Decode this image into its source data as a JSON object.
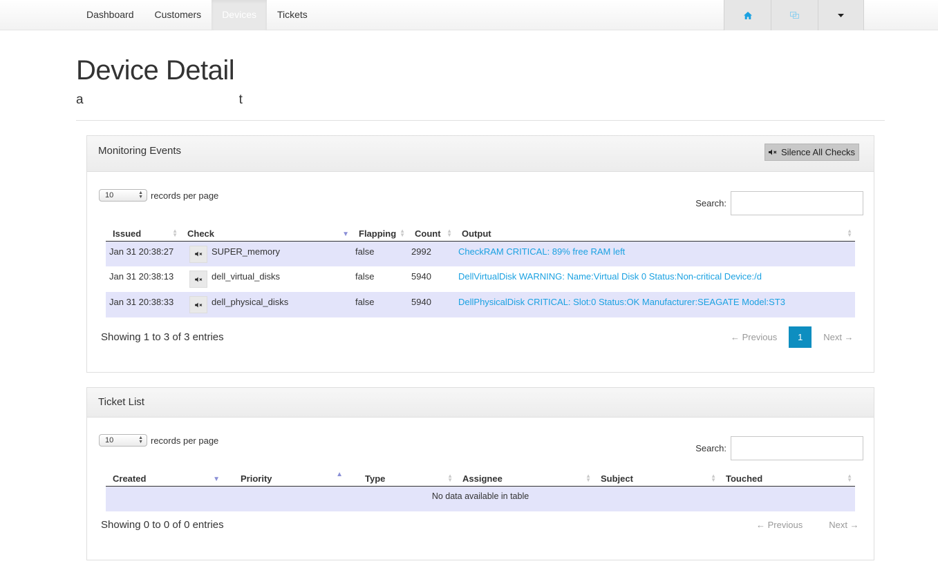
{
  "nav": {
    "items": [
      "Dashboard",
      "Customers",
      "Devices",
      "Tickets"
    ],
    "active": "Devices"
  },
  "header": {
    "title": "Device Detail",
    "subtitle_start": "a",
    "subtitle_end": "t"
  },
  "monitoring": {
    "title": "Monitoring Events",
    "silence_label": "Silence All Checks",
    "rpp_value": "10",
    "rpp_label": "records per page",
    "search_label": "Search:",
    "columns": [
      "Issued",
      "Check",
      "Flapping",
      "Count",
      "Output"
    ],
    "rows": [
      {
        "issued": "Jan 31 20:38:27",
        "check": "SUPER_memory",
        "flapping": "false",
        "count": "2992",
        "output": "CheckRAM CRITICAL: 89% free RAM left"
      },
      {
        "issued": "Jan 31 20:38:13",
        "check": "dell_virtual_disks",
        "flapping": "false",
        "count": "5940",
        "output": "DellVirtualDisk WARNING: Name:Virtual Disk 0 Status:Non-critical Device:/d"
      },
      {
        "issued": "Jan 31 20:38:33",
        "check": "dell_physical_disks",
        "flapping": "false",
        "count": "5940",
        "output": "DellPhysicalDisk CRITICAL: Slot:0 Status:OK Manufacturer:SEAGATE Model:ST3"
      }
    ],
    "info": "Showing 1 to 3 of 3 entries",
    "prev": "← Previous",
    "page": "1",
    "next": "Next →"
  },
  "tickets": {
    "title": "Ticket List",
    "rpp_value": "10",
    "rpp_label": "records per page",
    "search_label": "Search:",
    "columns": [
      "Created",
      "Priority",
      "Type",
      "Assignee",
      "Subject",
      "Touched"
    ],
    "empty": "No data available in table",
    "info": "Showing 0 to 0 of 0 entries",
    "prev": "← Previous",
    "next": "Next →"
  },
  "colors": {
    "accent": "#1aa1e1",
    "page_active": "#0e8ec0",
    "row_highlight": "#e3e4fa"
  }
}
